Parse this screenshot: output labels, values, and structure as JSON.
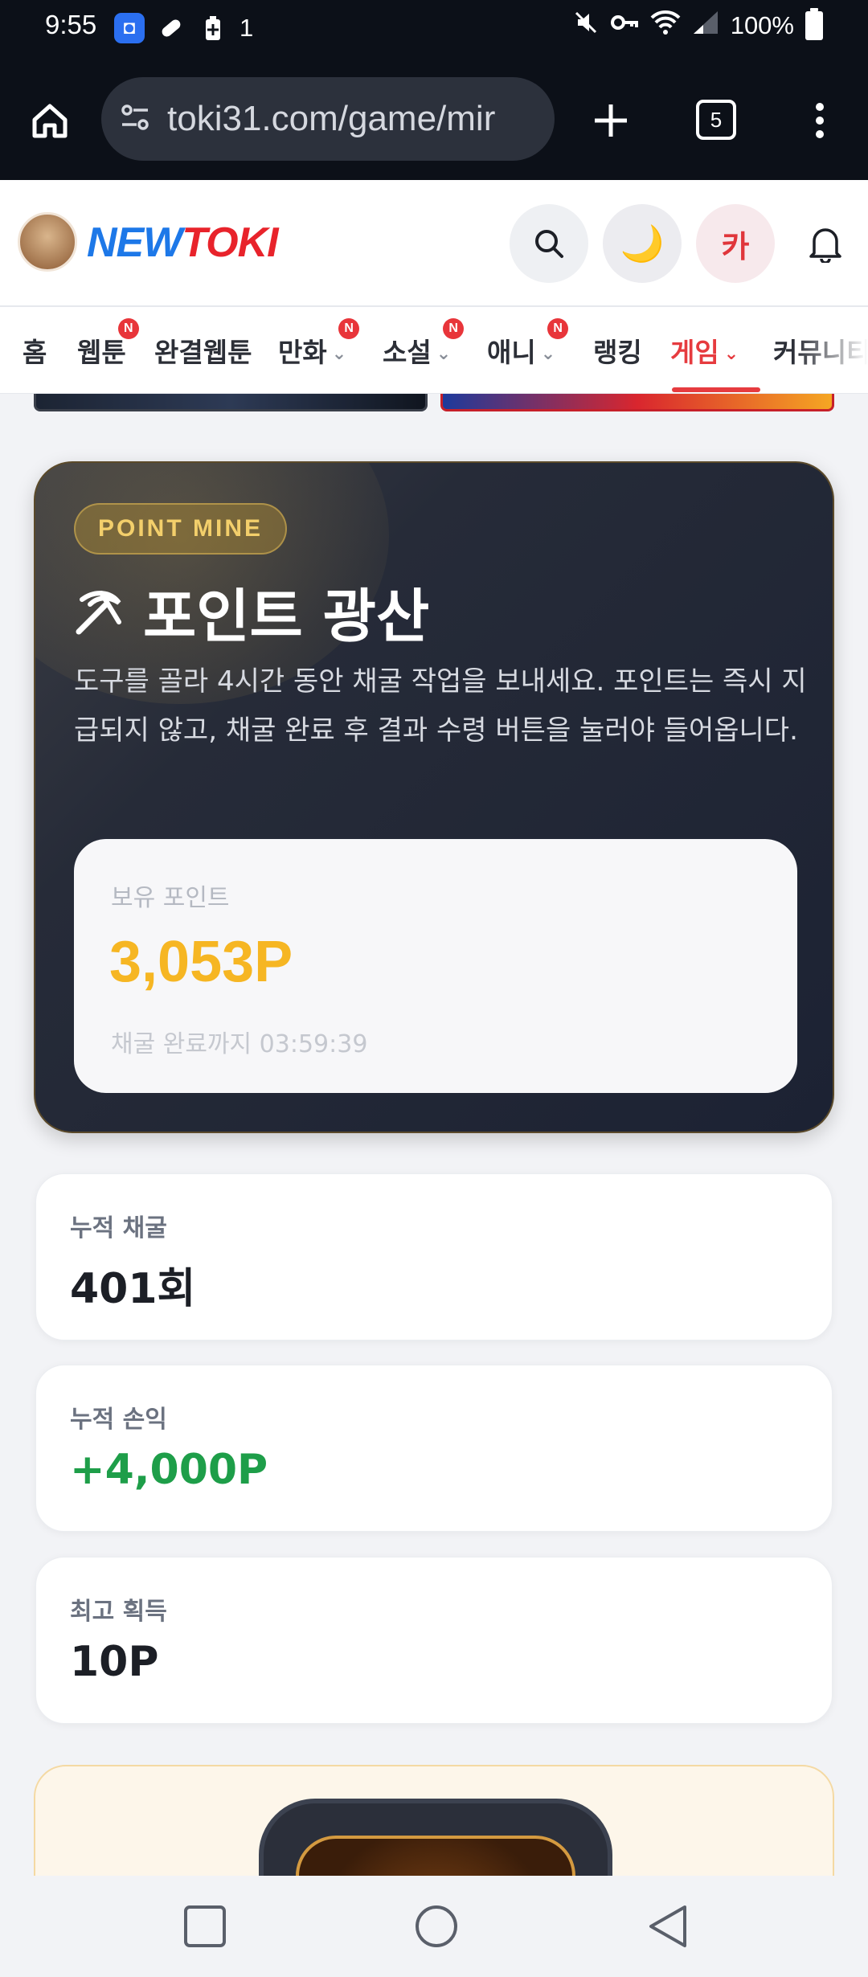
{
  "status_bar": {
    "time": "9:55",
    "notification_badge": "1",
    "battery_text": "100%"
  },
  "browser": {
    "url": "toki31.com/game/mir",
    "tab_count": "5"
  },
  "header": {
    "logo_new": "NEW",
    "logo_toki": "TOKI",
    "kakao_label": "카",
    "moon_glyph": "🌙"
  },
  "nav": {
    "items": [
      {
        "label": "홈",
        "badge": ""
      },
      {
        "label": "웹툰",
        "badge": "N"
      },
      {
        "label": "완결웹툰",
        "badge": ""
      },
      {
        "label": "만화",
        "badge": "N"
      },
      {
        "label": "소설",
        "badge": "N"
      },
      {
        "label": "애니",
        "badge": "N"
      },
      {
        "label": "랭킹",
        "badge": ""
      },
      {
        "label": "게임",
        "badge": ""
      },
      {
        "label": "커뮤니티",
        "badge": ""
      }
    ],
    "accent_color": "#e63b3f"
  },
  "hero": {
    "chip": "POINT MINE",
    "title": "포인트 광산",
    "description": "도구를 골라 4시간 동안 채굴 작업을 보내세요. 포인트는 즉시 지급되지 않고, 채굴 완료 후 결과 수령 버튼을 눌러야 들어옵니다.",
    "points_label": "보유 포인트",
    "points_value": "3,053P",
    "timer": "채굴 완료까지 03:59:39"
  },
  "stats": [
    {
      "label": "누적 채굴",
      "value": "401회"
    },
    {
      "label": "누적 손익",
      "value": "+4,000P"
    },
    {
      "label": "최고 획득",
      "value": "10P"
    }
  ],
  "icons": {
    "home": "home-icon",
    "site_settings": "site-settings-icon",
    "new_tab": "plus-icon",
    "menu": "kebab-menu-icon",
    "search": "search-icon",
    "theme": "moon-icon",
    "bell": "bell-icon",
    "pickaxe": "pickaxe-icon",
    "recents": "square-icon",
    "home_sys": "circle-icon",
    "back": "triangle-back-icon"
  }
}
